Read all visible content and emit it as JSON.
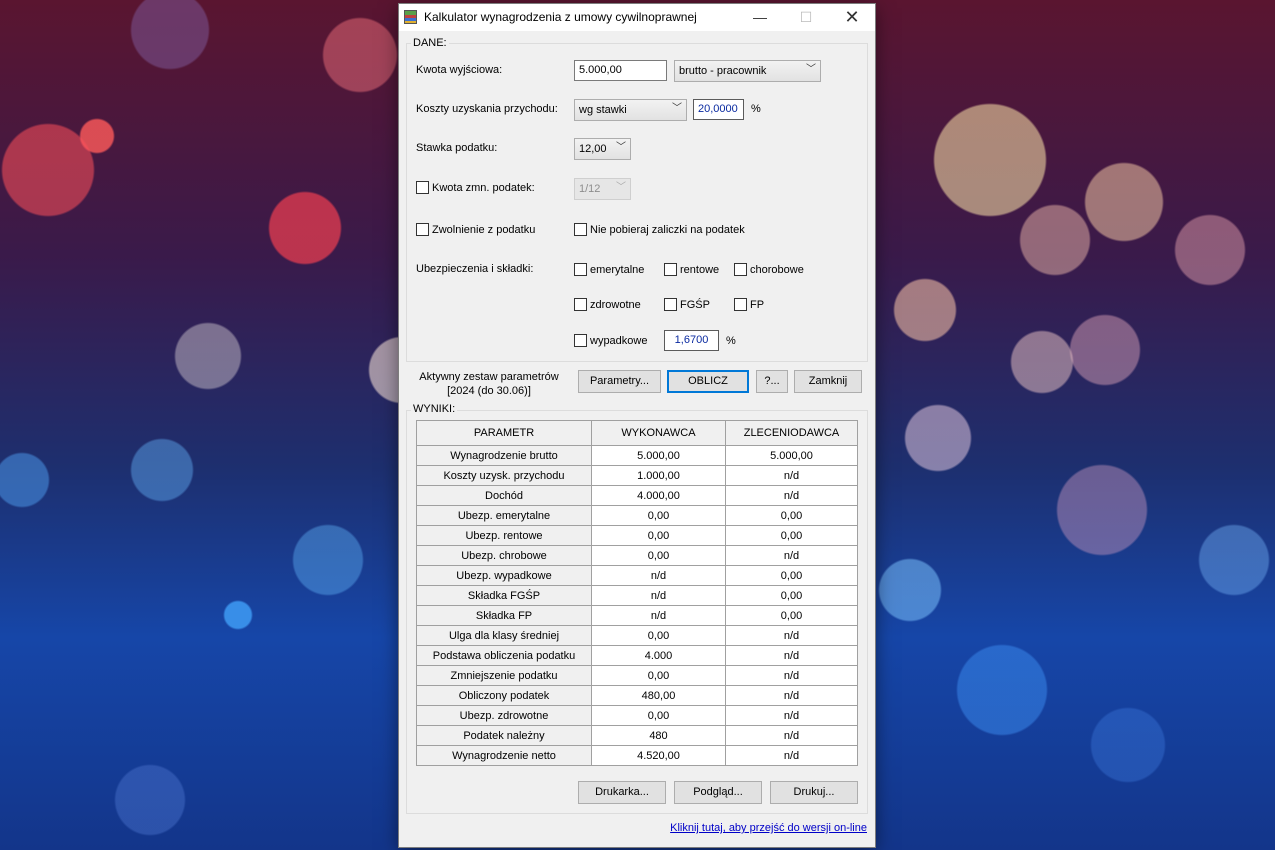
{
  "window": {
    "title": "Kalkulator wynagrodzenia z umowy cywilnoprawnej",
    "min_icon": "minimize-icon",
    "max_icon": "maximize-icon",
    "close_icon": "close-icon"
  },
  "dane": {
    "group_label": "DANE:",
    "kwota_label": "Kwota wyjściowa:",
    "kwota_value": "5.000,00",
    "kwota_type": "brutto - pracownik",
    "koszty_label": "Koszty uzyskania przychodu:",
    "koszty_mode": "wg stawki",
    "koszty_rate": "20,0000",
    "percent": "%",
    "stawka_label": "Stawka podatku:",
    "stawka_value": "12,00",
    "kwota_zmn_label": "Kwota zmn. podatek:",
    "kwota_zmn_value": "1/12",
    "zwolnienie_label": "Zwolnienie z podatku",
    "nie_pobieraj_label": "Nie pobieraj zaliczki na podatek",
    "ubezp_label": "Ubezpieczenia i składki:",
    "emerytalne": "emerytalne",
    "rentowe": "rentowe",
    "chorobowe": "chorobowe",
    "zdrowotne": "zdrowotne",
    "fgsp": "FGŚP",
    "fp": "FP",
    "wypadkowe": "wypadkowe",
    "wypadkowe_rate": "1,6700"
  },
  "actions": {
    "active_set_line1": "Aktywny zestaw parametrów",
    "active_set_line2": "[2024 (do 30.06)]",
    "parametry": "Parametry...",
    "oblicz": "OBLICZ",
    "help": "?...",
    "zamknij": "Zamknij"
  },
  "wyniki": {
    "group_label": "WYNIKI:",
    "headers": [
      "PARAMETR",
      "WYKONAWCA",
      "ZLECENIODAWCA"
    ],
    "rows": [
      [
        "Wynagrodzenie brutto",
        "5.000,00",
        "5.000,00"
      ],
      [
        "Koszty uzysk. przychodu",
        "1.000,00",
        "n/d"
      ],
      [
        "Dochód",
        "4.000,00",
        "n/d"
      ],
      [
        "Ubezp. emerytalne",
        "0,00",
        "0,00"
      ],
      [
        "Ubezp. rentowe",
        "0,00",
        "0,00"
      ],
      [
        "Ubezp. chrobowe",
        "0,00",
        "n/d"
      ],
      [
        "Ubezp. wypadkowe",
        "n/d",
        "0,00"
      ],
      [
        "Składka FGŚP",
        "n/d",
        "0,00"
      ],
      [
        "Składka FP",
        "n/d",
        "0,00"
      ],
      [
        "Ulga dla klasy średniej",
        "0,00",
        "n/d"
      ],
      [
        "Podstawa obliczenia podatku",
        "4.000",
        "n/d"
      ],
      [
        "Zmniejszenie podatku",
        "0,00",
        "n/d"
      ],
      [
        "Obliczony podatek",
        "480,00",
        "n/d"
      ],
      [
        "Ubezp. zdrowotne",
        "0,00",
        "n/d"
      ],
      [
        "Podatek należny",
        "480",
        "n/d"
      ],
      [
        "Wynagrodzenie netto",
        "4.520,00",
        "n/d"
      ]
    ],
    "drukarka": "Drukarka...",
    "podglad": "Podgląd...",
    "drukuj": "Drukuj..."
  },
  "footer_link": "Kliknij tutaj, aby przejść do wersji on-line"
}
